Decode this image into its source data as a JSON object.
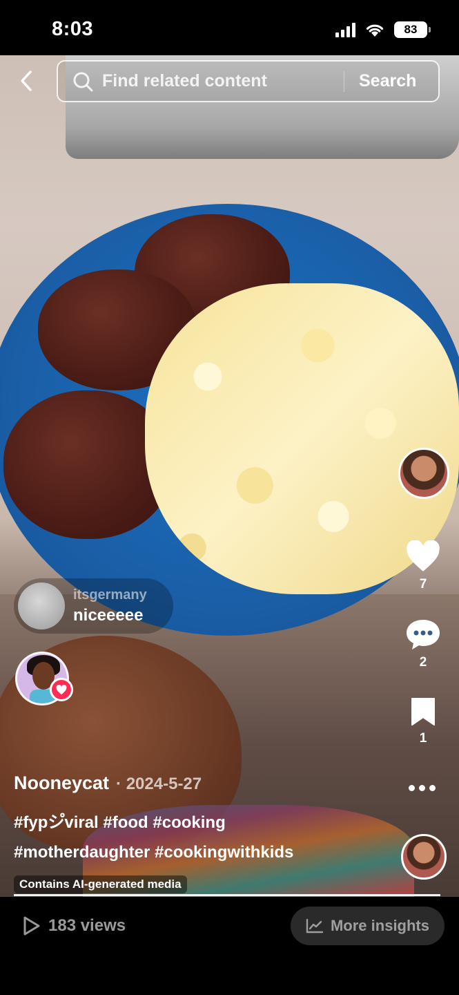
{
  "status_bar": {
    "time": "8:03",
    "battery": "83"
  },
  "search": {
    "placeholder": "Find related content",
    "button_label": "Search"
  },
  "comment_preview": {
    "username": "itsgermany",
    "text": "niceeeee"
  },
  "actions": {
    "likes": "7",
    "comments": "2",
    "saves": "1"
  },
  "post": {
    "creator": "Nooneycat",
    "date": "· 2024-5-27",
    "hashtags_line1": "#fypシ゚viral #food #cooking",
    "hashtags_line2": "#motherdaughter #cookingwithkids",
    "ai_label": "Contains AI-generated media",
    "progress": 1.0
  },
  "bottom": {
    "views": "183 views",
    "insights_label": "More insights"
  },
  "colors": {
    "like_badge": "#fe2c55",
    "plate": "#1a5fa8"
  }
}
